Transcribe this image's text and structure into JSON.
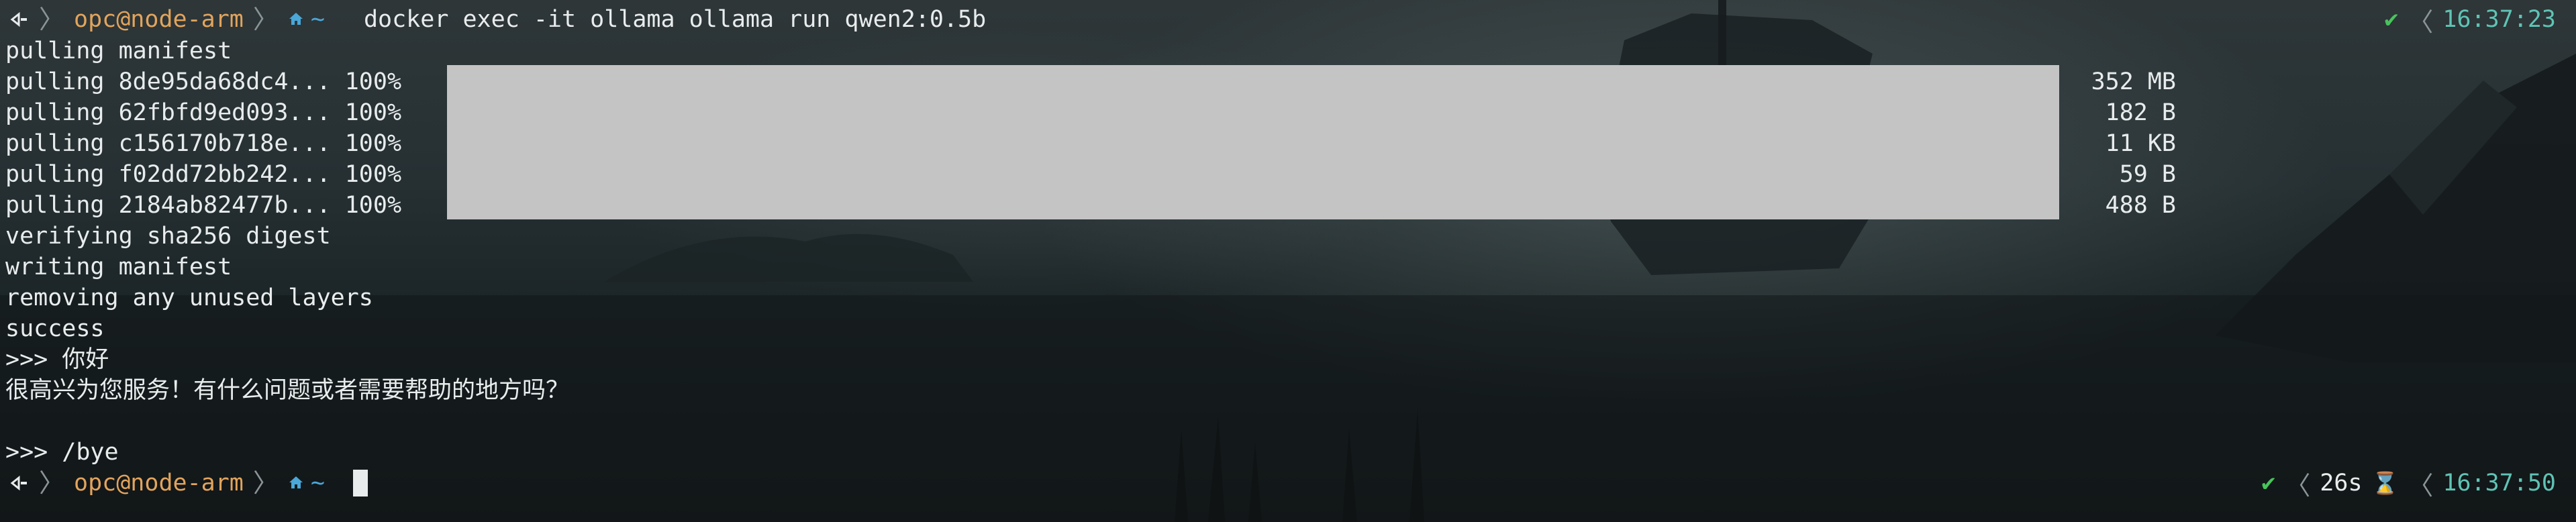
{
  "prompt": {
    "os_icon": "terminal-prompt-icon",
    "user_host": "opc@node-arm",
    "home_icon": "home-icon",
    "path": "~"
  },
  "command": "docker exec -it ollama ollama run qwen2:0.5b",
  "status_top": {
    "ok_icon": "check-icon",
    "time": "16:37:23"
  },
  "status_bottom": {
    "ok_icon": "check-icon",
    "duration": "26s",
    "hourglass_icon": "hourglass-icon",
    "time": "16:37:50"
  },
  "output": {
    "pulling_manifest": "pulling manifest",
    "layers": [
      {
        "label": "pulling 8de95da68dc4... 100%",
        "progress": 1.0,
        "size": "352 MB"
      },
      {
        "label": "pulling 62fbfd9ed093... 100%",
        "progress": 1.0,
        "size": "182 B"
      },
      {
        "label": "pulling c156170b718e... 100%",
        "progress": 1.0,
        "size": "11 KB"
      },
      {
        "label": "pulling f02dd72bb242... 100%",
        "progress": 1.0,
        "size": "59 B"
      },
      {
        "label": "pulling 2184ab82477b... 100%",
        "progress": 1.0,
        "size": "488 B"
      }
    ],
    "verifying": "verifying sha256 digest",
    "writing": "writing manifest",
    "removing": "removing any unused layers",
    "success": "success",
    "input1": ">>> 你好",
    "reply1": "很高兴为您服务！有什么问题或者需要帮助的地方吗？",
    "input2": ">>> /bye"
  },
  "colors": {
    "user_host": "#e2a45c",
    "path": "#4aa7d8",
    "ok": "#47c45b",
    "time": "#5fc4b5",
    "progress_bar": "#c4c4c4"
  }
}
